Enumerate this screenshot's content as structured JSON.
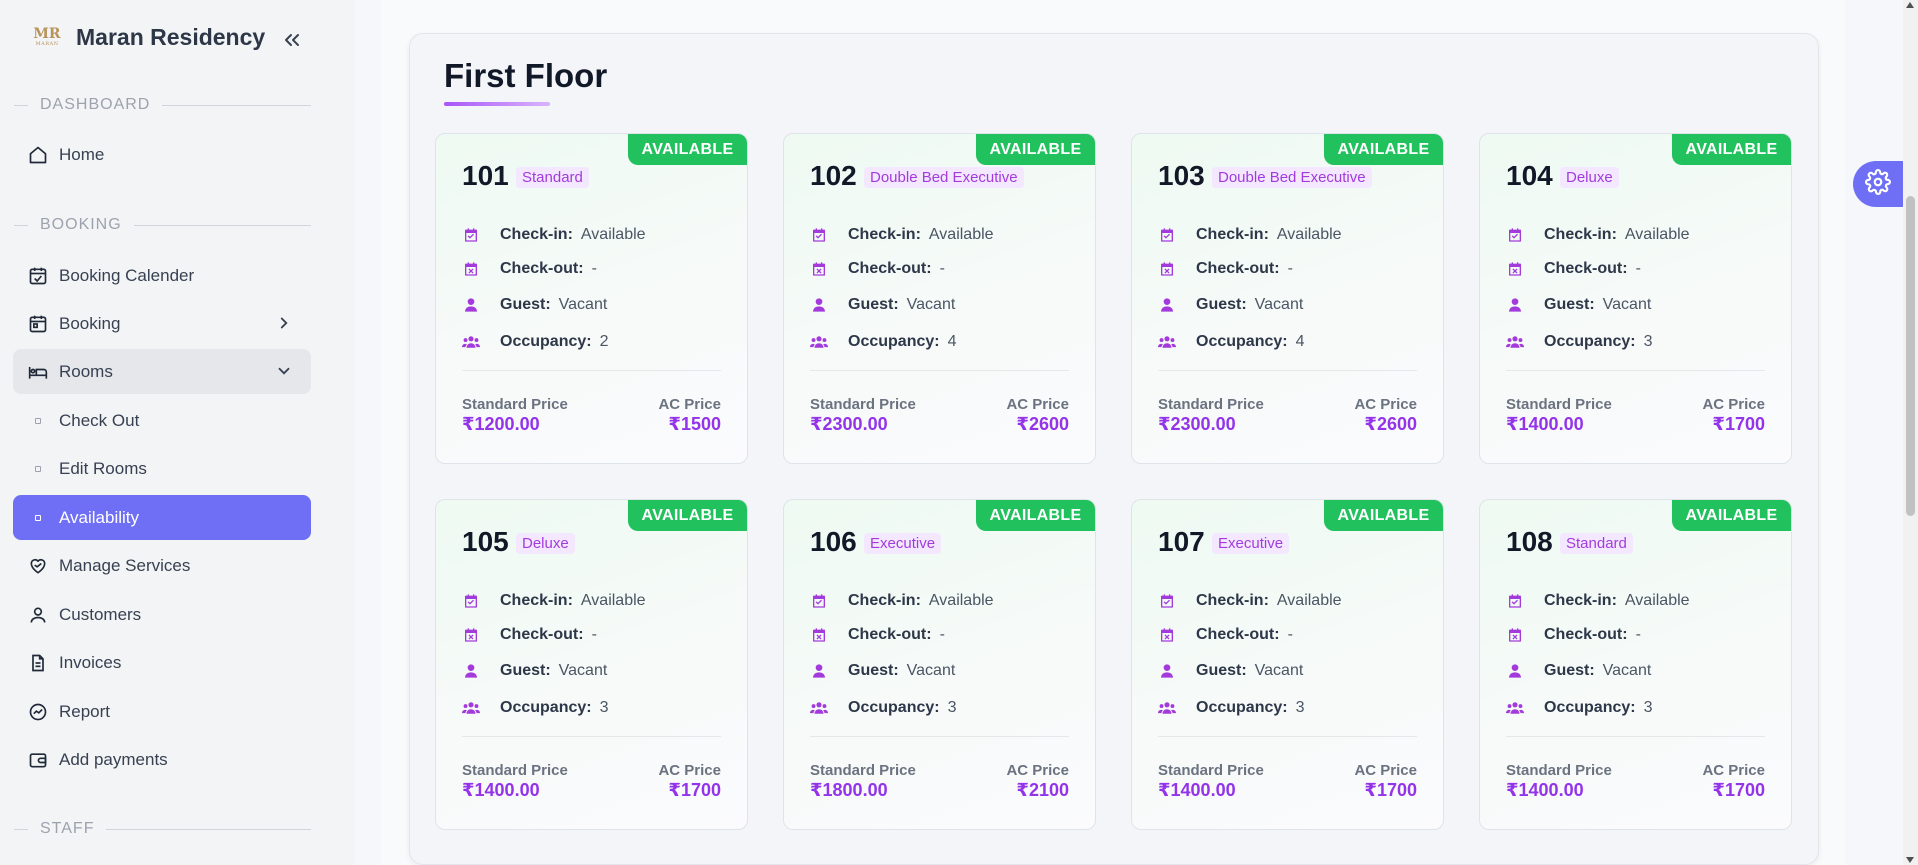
{
  "brand": {
    "logo_text": "MR",
    "logo_subtext": "MARAN",
    "title": "Maran Residency"
  },
  "sidebar": {
    "sections": [
      {
        "label": "DASHBOARD"
      },
      {
        "label": "BOOKING"
      },
      {
        "label": "STAFF"
      }
    ],
    "items": [
      {
        "label": "Home",
        "icon": "home-icon"
      },
      {
        "label": "Booking Calender",
        "icon": "calendar-check-icon"
      },
      {
        "label": "Booking",
        "icon": "calendar-icon"
      },
      {
        "label": "Rooms",
        "icon": "bed-icon"
      },
      {
        "label": "Check Out",
        "icon": "sub-item-icon"
      },
      {
        "label": "Edit Rooms",
        "icon": "sub-item-icon"
      },
      {
        "label": "Availability",
        "icon": "sub-item-icon",
        "active": true
      },
      {
        "label": "Manage Services",
        "icon": "heart-hand-icon"
      },
      {
        "label": "Customers",
        "icon": "user-icon"
      },
      {
        "label": "Invoices",
        "icon": "document-icon"
      },
      {
        "label": "Report",
        "icon": "chart-icon"
      },
      {
        "label": "Add payments",
        "icon": "wallet-icon"
      }
    ]
  },
  "main": {
    "floor_title": "First Floor",
    "labels": {
      "check_in": "Check-in:",
      "check_out": "Check-out:",
      "guest": "Guest:",
      "occupancy": "Occupancy:",
      "standard_price": "Standard Price",
      "ac_price": "AC Price"
    },
    "rooms": [
      {
        "number": "101",
        "type": "Standard",
        "status": "AVAILABLE",
        "check_in": "Available",
        "check_out": "-",
        "guest": "Vacant",
        "occupancy": "2",
        "standard_price": "₹1200.00",
        "ac_price": "₹1500"
      },
      {
        "number": "102",
        "type": "Double Bed Executive",
        "status": "AVAILABLE",
        "check_in": "Available",
        "check_out": "-",
        "guest": "Vacant",
        "occupancy": "4",
        "standard_price": "₹2300.00",
        "ac_price": "₹2600"
      },
      {
        "number": "103",
        "type": "Double Bed Executive",
        "status": "AVAILABLE",
        "check_in": "Available",
        "check_out": "-",
        "guest": "Vacant",
        "occupancy": "4",
        "standard_price": "₹2300.00",
        "ac_price": "₹2600"
      },
      {
        "number": "104",
        "type": "Deluxe",
        "status": "AVAILABLE",
        "check_in": "Available",
        "check_out": "-",
        "guest": "Vacant",
        "occupancy": "3",
        "standard_price": "₹1400.00",
        "ac_price": "₹1700"
      },
      {
        "number": "105",
        "type": "Deluxe",
        "status": "AVAILABLE",
        "check_in": "Available",
        "check_out": "-",
        "guest": "Vacant",
        "occupancy": "3",
        "standard_price": "₹1400.00",
        "ac_price": "₹1700"
      },
      {
        "number": "106",
        "type": "Executive",
        "status": "AVAILABLE",
        "check_in": "Available",
        "check_out": "-",
        "guest": "Vacant",
        "occupancy": "3",
        "standard_price": "₹1800.00",
        "ac_price": "₹2100"
      },
      {
        "number": "107",
        "type": "Executive",
        "status": "AVAILABLE",
        "check_in": "Available",
        "check_out": "-",
        "guest": "Vacant",
        "occupancy": "3",
        "standard_price": "₹1400.00",
        "ac_price": "₹1700"
      },
      {
        "number": "108",
        "type": "Standard",
        "status": "AVAILABLE",
        "check_in": "Available",
        "check_out": "-",
        "guest": "Vacant",
        "occupancy": "3",
        "standard_price": "₹1400.00",
        "ac_price": "₹1700"
      }
    ]
  },
  "colors": {
    "accent": "#6e6ff5",
    "available": "#21c25e",
    "price": "#9333ea",
    "icon": "#a33bdc"
  }
}
